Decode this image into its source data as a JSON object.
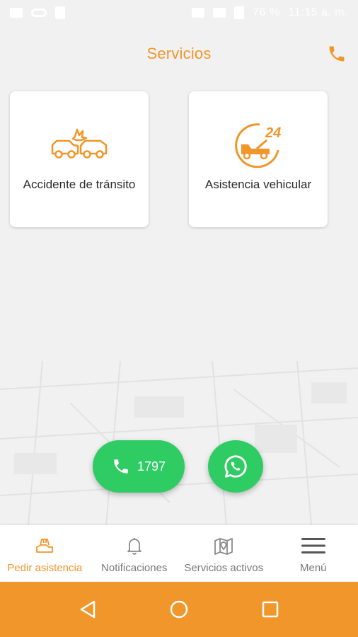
{
  "status_bar": {
    "battery": "76 %",
    "time": "11:15 a. m."
  },
  "header": {
    "title": "Servicios",
    "phone_icon": "phone-icon"
  },
  "services": [
    {
      "label": "Accidente de tránsito",
      "icon": "car-crash-icon"
    },
    {
      "label": "Asistencia vehicular",
      "icon": "tow-truck-24-icon",
      "badge": "24"
    }
  ],
  "actions": {
    "call_number": "1797",
    "whatsapp_icon": "whatsapp-icon"
  },
  "bottom_nav": {
    "items": [
      {
        "label": "Pedir asistencia",
        "icon": "hand-car-icon",
        "active": true
      },
      {
        "label": "Notificaciones",
        "icon": "bell-icon",
        "active": false
      },
      {
        "label": "Servicios activos",
        "icon": "map-pin-icon",
        "active": false
      },
      {
        "label": "Menú",
        "icon": "hamburger-icon",
        "active": false
      }
    ]
  },
  "colors": {
    "accent": "#f0962a",
    "green": "#2ecc63",
    "background": "#f1f1f1"
  }
}
